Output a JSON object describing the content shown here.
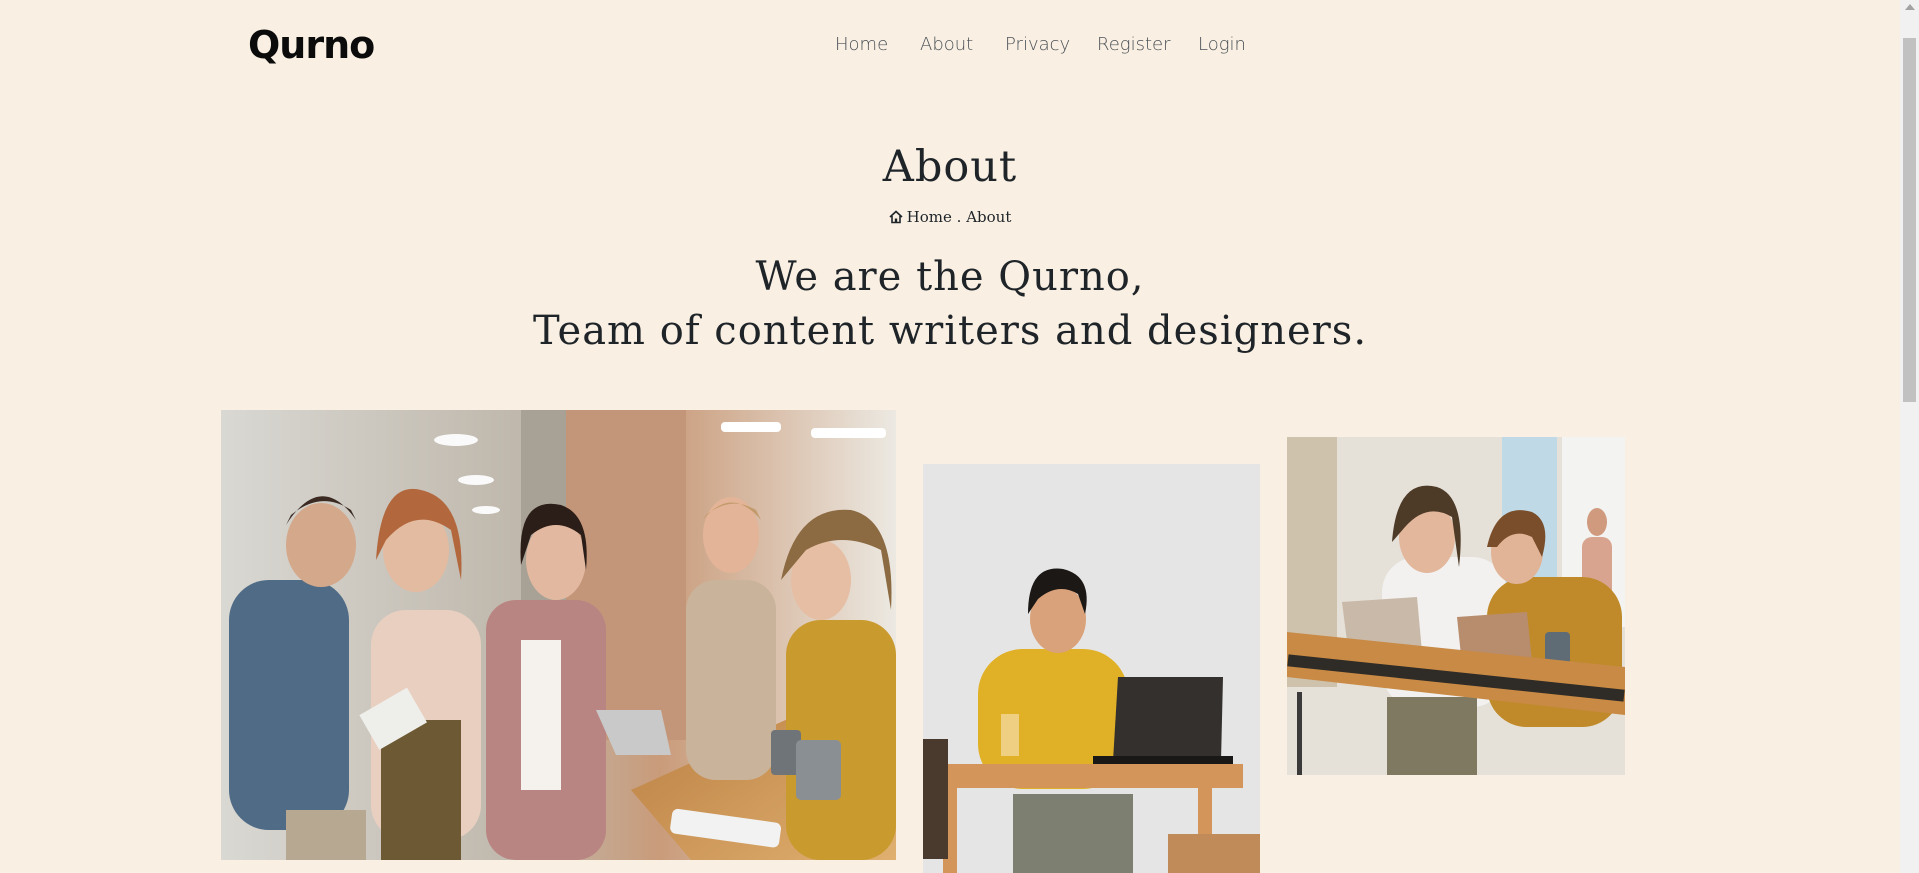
{
  "brand": {
    "logo": "Qurno"
  },
  "nav": {
    "home": "Home",
    "about": "About",
    "privacy": "Privacy",
    "register": "Register",
    "login": "Login"
  },
  "page": {
    "title": "About",
    "breadcrumb": {
      "icon": "home-icon",
      "home": "Home",
      "separator": " . ",
      "current": "About"
    },
    "intro": {
      "line1": "We are the Qurno,",
      "line2": "Team of content writers and designers."
    }
  },
  "colors": {
    "background": "#f9f0e3",
    "text": "#1f2429",
    "nav_text": "#4a4f55"
  }
}
